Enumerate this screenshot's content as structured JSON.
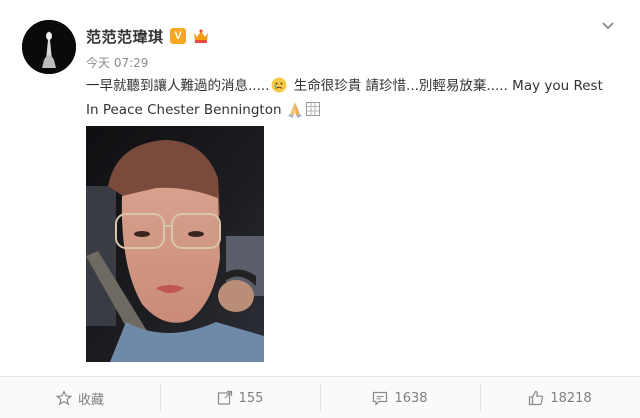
{
  "post": {
    "author": "范范范瑋琪",
    "time": "今天 07:29",
    "text_part1": "一早就聽到讓人難過的消息.....",
    "text_part2": " 生命很珍貴 請珍惜...別輕易放棄.....  May you Rest In Peace Chester Bennington",
    "verified_badge": "V"
  },
  "actions": {
    "favorite_label": "收藏",
    "repost_count": "155",
    "comment_count": "1638",
    "like_count": "18218"
  },
  "colors": {
    "badge": "#f5a623",
    "text": "#333333",
    "muted": "#8c8c8c"
  }
}
